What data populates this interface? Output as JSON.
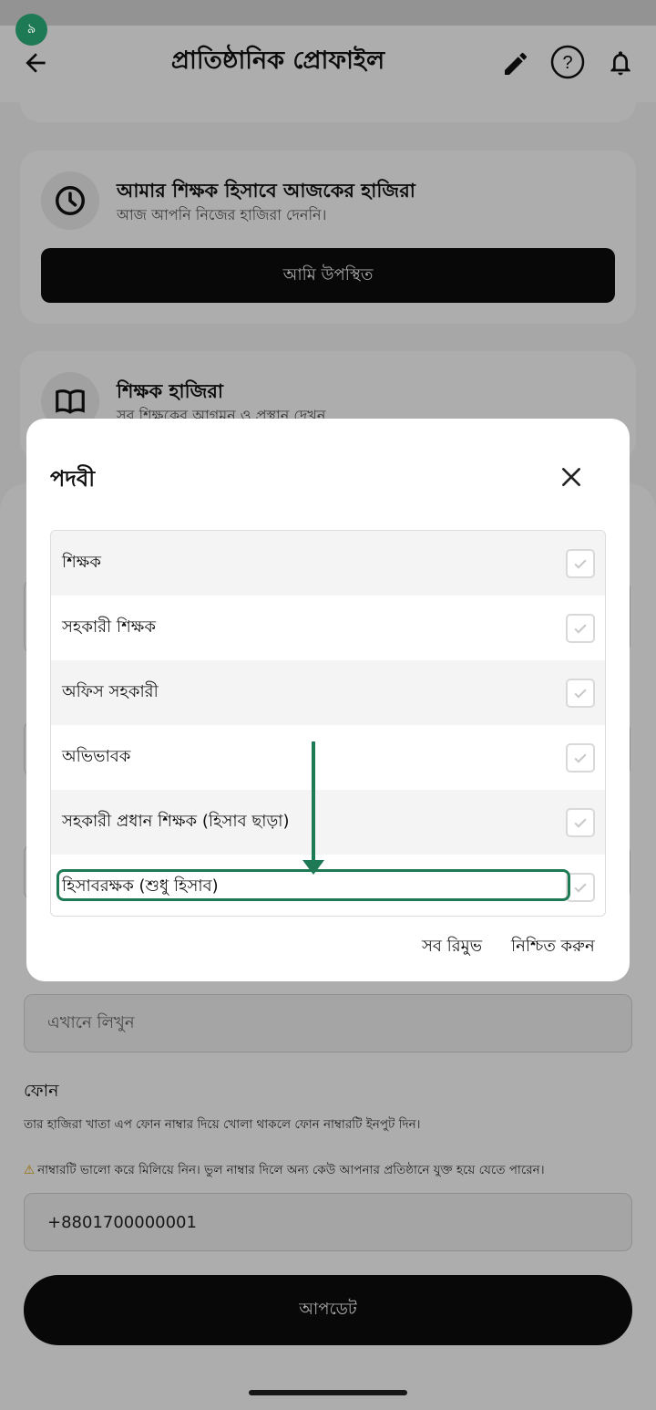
{
  "status": {
    "badge": "৯"
  },
  "appbar": {
    "title": "প্রাতিষ্ঠানিক প্রোফাইল",
    "icons": {
      "back": "arrow-back-icon",
      "edit": "pencil-icon",
      "help": "help-circle-icon",
      "notifications": "bell-icon"
    }
  },
  "cards": {
    "attendance_self": {
      "title": "আমার শিক্ষক হিসাবে আজকের হাজিরা",
      "subtitle": "আজ আপনি নিজের হাজিরা দেননি।",
      "button": "আমি উপস্থিত",
      "icon": "clock-icon"
    },
    "teacher_attendance": {
      "title": "শিক্ষক হাজিরা",
      "subtitle": "সব শিক্ষকের আগমন ও প্রস্থান দেখুন",
      "icon": "book-icon"
    }
  },
  "form": {
    "write_placeholder": "এখানে লিখুন",
    "phone_label": "ফোন",
    "phone_helper": "তার হাজিরা খাতা এপ ফোন নাম্বার দিয়ে খোলা থাকলে ফোন নাম্বারটি ইনপুট দিন।",
    "phone_warning": "নাম্বারটি ভালো করে মিলিয়ে নিন। ভুল নাম্বার দিলে অন্য কেউ আপনার প্রতিষ্ঠানে যুক্ত হয়ে যেতে পারেন।",
    "phone_value": "+8801700000001",
    "update_button": "আপডেট"
  },
  "dialog": {
    "title": "পদবী",
    "options": [
      {
        "label": "শিক্ষক",
        "checked": false
      },
      {
        "label": "সহকারী শিক্ষক",
        "checked": false
      },
      {
        "label": "অফিস সহকারী",
        "checked": false
      },
      {
        "label": "অভিভাবক",
        "checked": false
      },
      {
        "label": "সহকারী প্রধান শিক্ষক (হিসাব ছাড়া)",
        "checked": false
      },
      {
        "label": "হিসাবরক্ষক (শুধু হিসাব)",
        "checked": false
      }
    ],
    "remove_all": "সব রিমুভ",
    "confirm": "নিশ্চিত করুন",
    "colors": {
      "highlight": "#1e7a55",
      "dark": "#0d0d0d"
    }
  }
}
